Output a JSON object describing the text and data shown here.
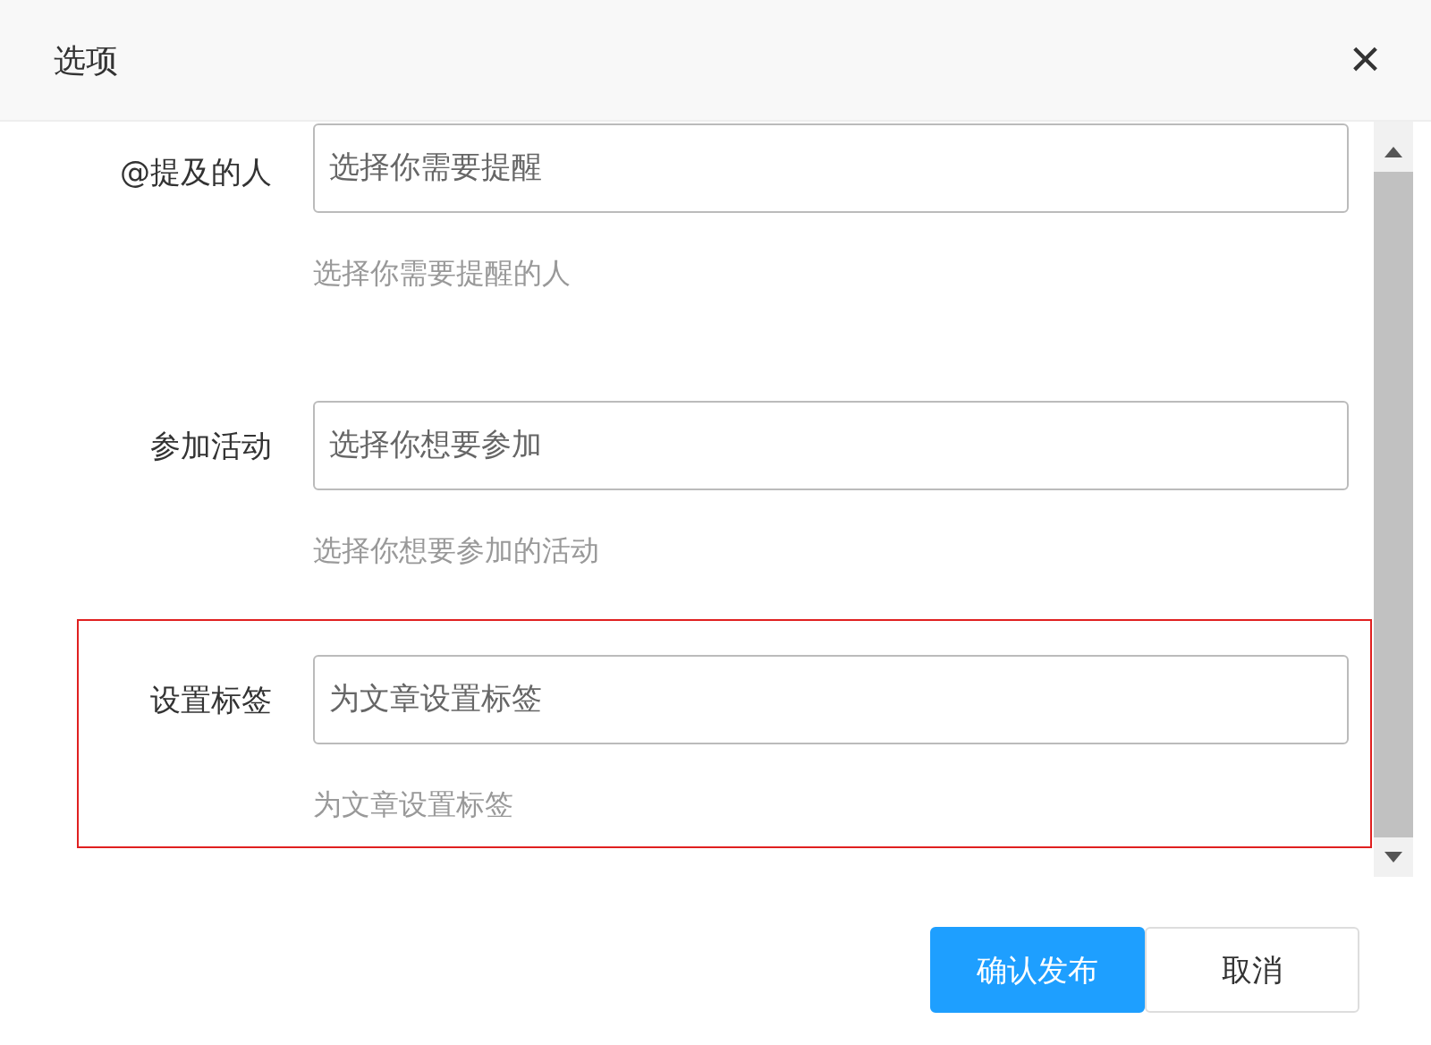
{
  "dialog": {
    "title": "选项",
    "close": "×"
  },
  "fields": [
    {
      "label": "@提及的人",
      "placeholder": "选择你需要提醒",
      "hint": "选择你需要提醒的人",
      "highlighted": false
    },
    {
      "label": "参加活动",
      "placeholder": "选择你想要参加",
      "hint": "选择你想要参加的活动",
      "highlighted": false
    },
    {
      "label": "设置标签",
      "placeholder": "为文章设置标签",
      "hint": "为文章设置标签",
      "highlighted": true
    }
  ],
  "buttons": [
    {
      "label": "确认发布",
      "kind": "primary"
    },
    {
      "label": "取消",
      "kind": "secondary"
    }
  ]
}
